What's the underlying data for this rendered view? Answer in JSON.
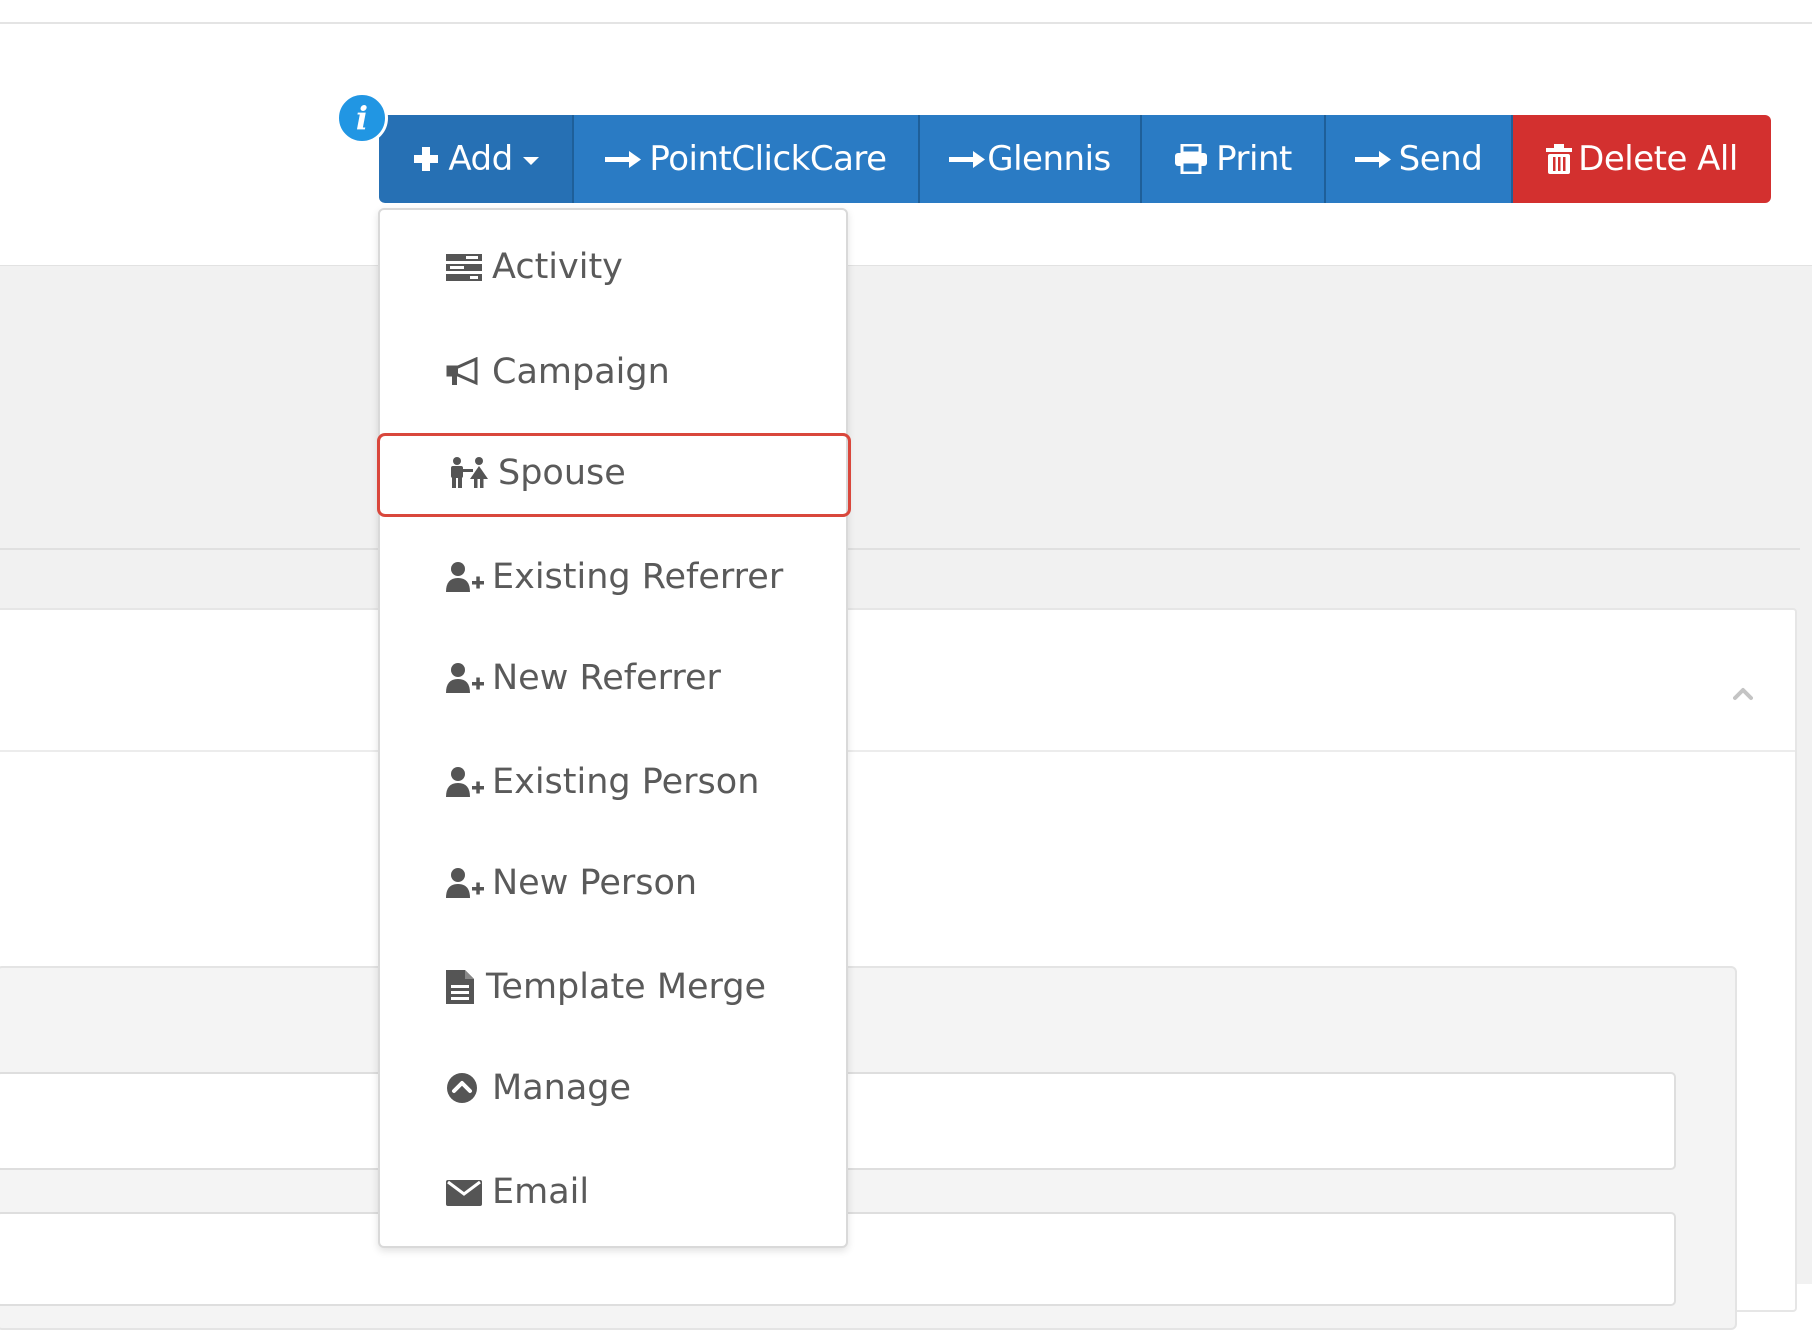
{
  "toolbar": {
    "info_badge": "i",
    "buttons": [
      {
        "label": "Add",
        "icon": "plus-icon",
        "has_caret": true
      },
      {
        "label": "PointClickCare",
        "icon": "arrow-right-icon"
      },
      {
        "label": "Glennis",
        "icon": "arrow-right-icon"
      },
      {
        "label": "Print",
        "icon": "print-icon"
      },
      {
        "label": "Send",
        "icon": "arrow-right-icon"
      },
      {
        "label": "Delete All",
        "icon": "trash-icon"
      }
    ]
  },
  "add_menu": {
    "items": [
      {
        "label": "Activity",
        "icon": "tasks-icon"
      },
      {
        "label": "Campaign",
        "icon": "bullhorn-icon"
      },
      {
        "label": "Spouse",
        "icon": "couple-icon",
        "highlighted": true
      },
      {
        "label": "Existing Referrer",
        "icon": "user-plus-icon"
      },
      {
        "label": "New Referrer",
        "icon": "user-plus-icon"
      },
      {
        "label": "Existing Person",
        "icon": "user-plus-icon"
      },
      {
        "label": "New Person",
        "icon": "user-plus-icon"
      },
      {
        "label": "Template Merge",
        "icon": "file-icon"
      },
      {
        "label": "Manage",
        "icon": "chevron-circle-up-icon"
      },
      {
        "label": "Email",
        "icon": "envelope-icon"
      }
    ]
  },
  "colors": {
    "primary": "#2a7bc4",
    "danger": "#d3302f",
    "info_badge": "#2196e3",
    "highlight_outline": "#d9473c"
  }
}
